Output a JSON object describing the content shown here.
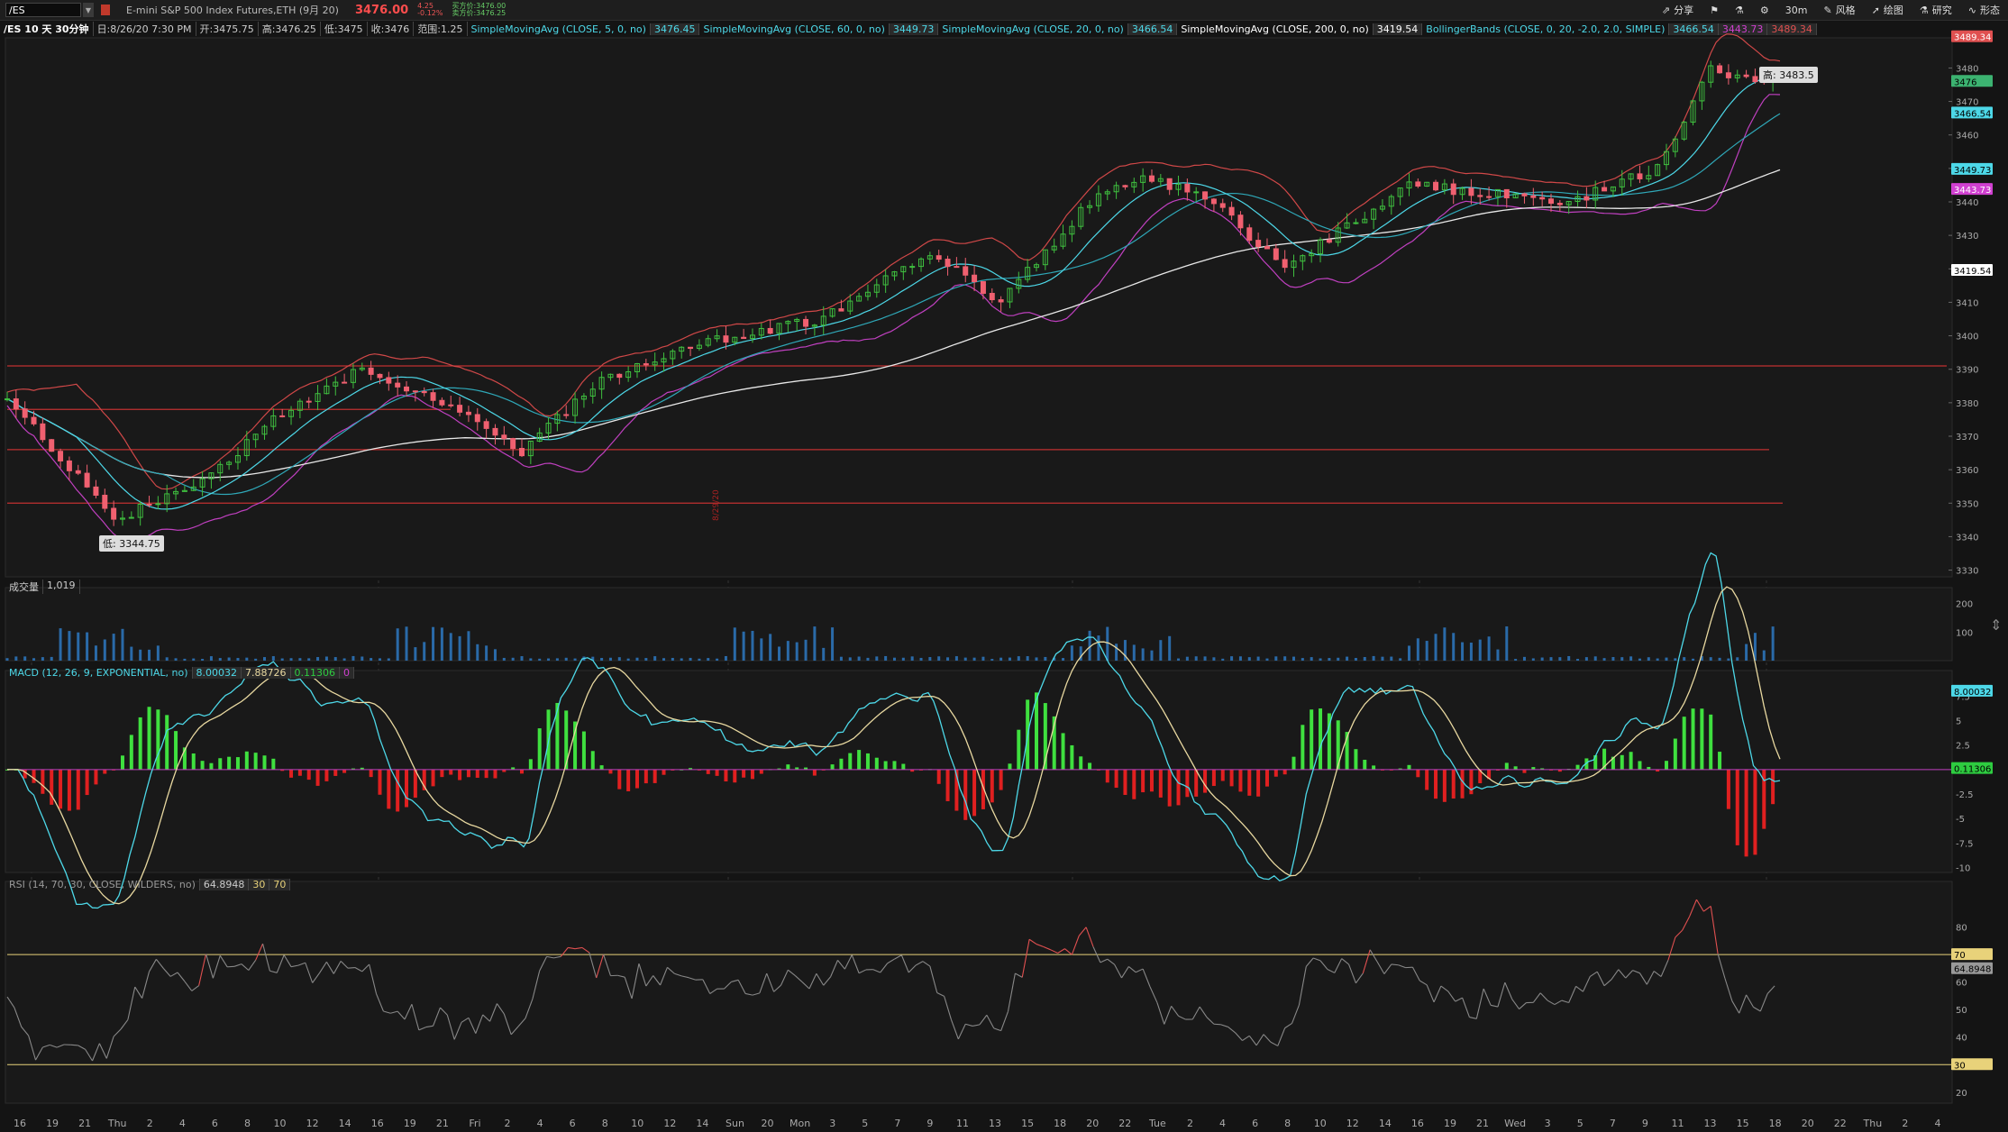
{
  "header": {
    "symbol": "/ES",
    "description": "E-mini S&P 500 Index Futures,ETH (9月 20)",
    "last_price": "3476.00",
    "change": "4.25",
    "change_pct": "-0.12%",
    "bid": "买方价:3476.00",
    "ask": "卖方价:3476.25"
  },
  "toolbar": [
    {
      "icon": "share-icon",
      "label": "分享"
    },
    {
      "icon": "flag-icon",
      "label": ""
    },
    {
      "icon": "flask-icon",
      "label": ""
    },
    {
      "icon": "gear-icon",
      "label": ""
    },
    {
      "icon": "timeframe",
      "label": "30m"
    },
    {
      "icon": "style-icon",
      "label": "风格"
    },
    {
      "icon": "draw-icon",
      "label": "绘图"
    },
    {
      "icon": "research-icon",
      "label": "研究"
    },
    {
      "icon": "pattern-icon",
      "label": "形态"
    }
  ],
  "infobar": {
    "title": "/ES 10 天 30分钟",
    "date": "日:8/26/20 7:30 PM",
    "open": "开:3475.75",
    "high": "高:3476.25",
    "low": "低:3475",
    "close": "收:3476",
    "range": "范围:1.25",
    "studies": [
      {
        "name": "SimpleMovingAvg (CLOSE, 5, 0, no)",
        "value": "3476.45",
        "color": "#4dd8e8"
      },
      {
        "name": "SimpleMovingAvg (CLOSE, 60, 0, no)",
        "value": "3449.73",
        "color": "#4dd8e8"
      },
      {
        "name": "SimpleMovingAvg (CLOSE, 20, 0, no)",
        "value": "3466.54",
        "color": "#4dd8e8"
      },
      {
        "name": "SimpleMovingAvg (CLOSE, 200, 0, no)",
        "value": "3419.54",
        "color": "#ffffff"
      },
      {
        "name": "BollingerBands (CLOSE, 0, 20, -2.0, 2.0, SIMPLE)",
        "value": "3466.54",
        "value2": "3443.73",
        "value3": "3489.34",
        "color": "#4dd8e8"
      }
    ]
  },
  "price_panel": {
    "y_ticks": [
      "3480",
      "3470",
      "3460",
      "3450",
      "3440",
      "3430",
      "3420",
      "3410",
      "3400",
      "3390",
      "3380",
      "3370",
      "3360",
      "3350",
      "3340",
      "3330"
    ],
    "badges": [
      {
        "text": "3489.34",
        "color": "#e05050"
      },
      {
        "text": "3476",
        "color": "#3cb371"
      },
      {
        "text": "3466.54",
        "color": "#4dd8e8"
      },
      {
        "text": "3449.73",
        "color": "#4dd8e8"
      },
      {
        "text": "3443.73",
        "color": "#d040d0"
      },
      {
        "text": "3419.54",
        "color": "#ffffff"
      }
    ],
    "high_label": "高: 3483.5",
    "low_label": "低: 3344.75",
    "vertical_marker": "8/29/20"
  },
  "volume_panel": {
    "label": "成交量",
    "value": "1,019",
    "y_ticks": [
      "200",
      "100"
    ]
  },
  "macd_panel": {
    "label": "MACD (12, 26, 9, EXPONENTIAL, no)",
    "value": "8.00032",
    "avg": "7.88726",
    "diff": "0.11306",
    "zero": "0",
    "y_ticks": [
      "7.5",
      "5",
      "2.5",
      "0",
      "-2.5",
      "-5",
      "-7.5",
      "-10"
    ],
    "badges": [
      {
        "text": "8.00032",
        "color": "#4dd8e8"
      },
      {
        "text": "0.11306",
        "color": "#2ecc40"
      }
    ]
  },
  "rsi_panel": {
    "label": "RSI (14, 70, 30, CLOSE, WILDERS, no)",
    "value": "64.8948",
    "os": "30",
    "ob": "70",
    "y_ticks": [
      "80",
      "60",
      "50",
      "40",
      "20"
    ],
    "badges": [
      {
        "text": "70",
        "color": "#e8d27a"
      },
      {
        "text": "64.8948",
        "color": "#999999"
      },
      {
        "text": "30",
        "color": "#e8d27a"
      }
    ]
  },
  "x_axis": [
    "16",
    "19",
    "21",
    "Thu",
    "2",
    "4",
    "6",
    "8",
    "10",
    "12",
    "14",
    "16",
    "19",
    "21",
    "Fri",
    "2",
    "4",
    "6",
    "8",
    "10",
    "12",
    "14",
    "Sun",
    "20",
    "Mon",
    "3",
    "5",
    "7",
    "9",
    "11",
    "13",
    "15",
    "18",
    "20",
    "22",
    "Tue",
    "2",
    "4",
    "6",
    "8",
    "10",
    "12",
    "14",
    "16",
    "19",
    "21",
    "Wed",
    "3",
    "5",
    "7",
    "9",
    "11",
    "13",
    "15",
    "18",
    "20",
    "22",
    "Thu",
    "2",
    "4"
  ]
}
